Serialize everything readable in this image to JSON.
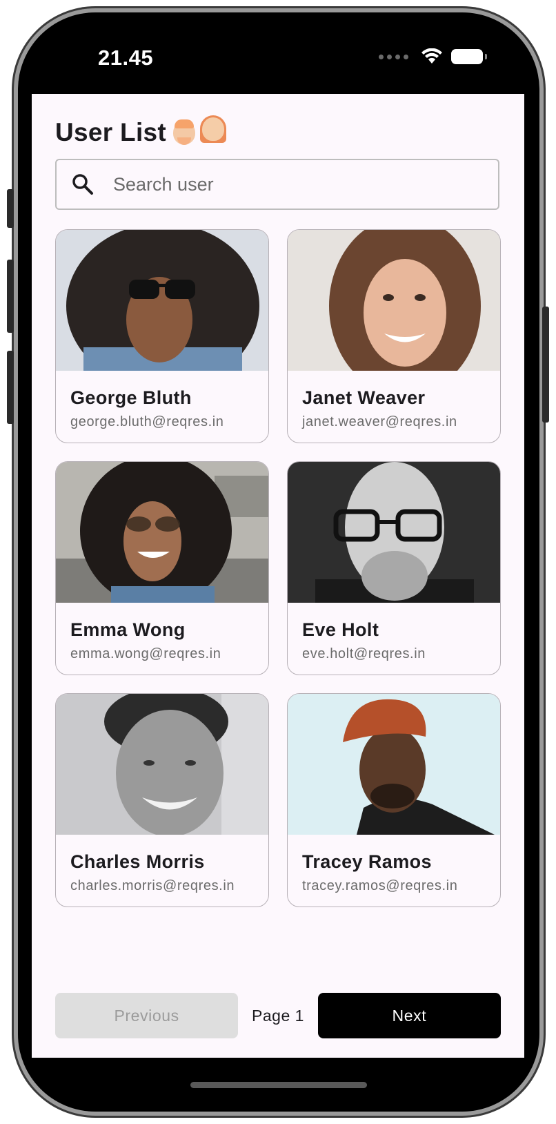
{
  "status_bar": {
    "time": "21.45"
  },
  "header": {
    "title": "User List"
  },
  "search": {
    "placeholder": "Search user"
  },
  "users": [
    {
      "name": "George Bluth",
      "email": "george.bluth@reqres.in"
    },
    {
      "name": "Janet Weaver",
      "email": "janet.weaver@reqres.in"
    },
    {
      "name": "Emma Wong",
      "email": "emma.wong@reqres.in"
    },
    {
      "name": "Eve Holt",
      "email": "eve.holt@reqres.in"
    },
    {
      "name": "Charles Morris",
      "email": "charles.morris@reqres.in"
    },
    {
      "name": "Tracey Ramos",
      "email": "tracey.ramos@reqres.in"
    }
  ],
  "pagination": {
    "previous_label": "Previous",
    "page_label": "Page 1",
    "next_label": "Next"
  },
  "colors": {
    "screen_background": "#fdf8fd",
    "primary_button": "#000000",
    "disabled_button": "#dedede"
  }
}
